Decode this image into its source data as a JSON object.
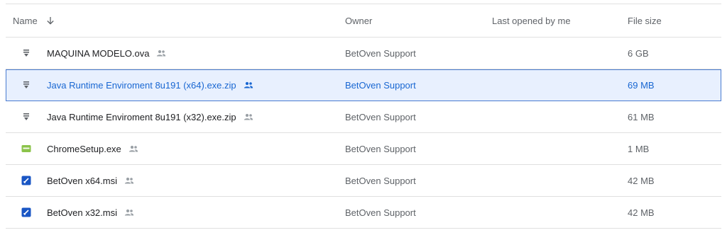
{
  "header": {
    "name": "Name",
    "owner": "Owner",
    "last_opened": "Last opened by me",
    "file_size": "File size"
  },
  "files": [
    {
      "name": "MAQUINA MODELO.ova",
      "owner": "BetOven Support",
      "size": "6 GB",
      "icon": "archive-file-icon",
      "selected": false
    },
    {
      "name": "Java Runtime Enviroment 8u191 (x64).exe.zip",
      "owner": "BetOven Support",
      "size": "69 MB",
      "icon": "archive-file-icon",
      "selected": true
    },
    {
      "name": "Java Runtime Enviroment 8u191 (x32).exe.zip",
      "owner": "BetOven Support",
      "size": "61 MB",
      "icon": "archive-file-icon",
      "selected": false
    },
    {
      "name": "ChromeSetup.exe",
      "owner": "BetOven Support",
      "size": "1 MB",
      "icon": "executable-file-icon",
      "selected": false
    },
    {
      "name": "BetOven x64.msi",
      "owner": "BetOven Support",
      "size": "42 MB",
      "icon": "installer-file-icon",
      "selected": false
    },
    {
      "name": "BetOven x32.msi",
      "owner": "BetOven Support",
      "size": "42 MB",
      "icon": "installer-file-icon",
      "selected": false
    }
  ],
  "colors": {
    "selected_bg": "#e8f0fe",
    "selected_text": "#1967d2",
    "exe_icon": "#8bc34a",
    "msi_icon": "#1a56c4"
  }
}
